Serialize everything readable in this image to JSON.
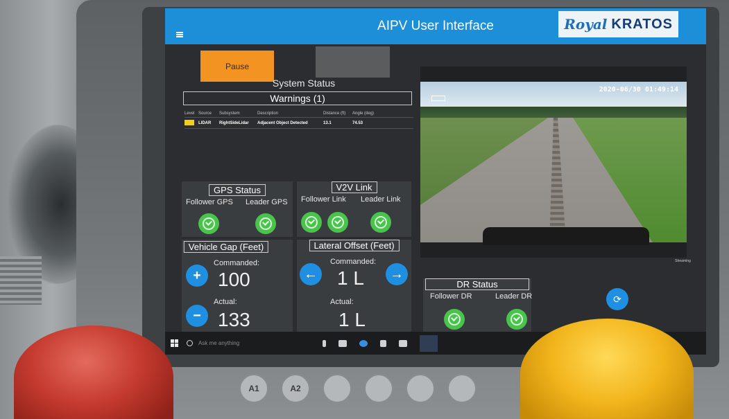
{
  "header": {
    "title": "AIPV User Interface",
    "brand_left": "Royal",
    "brand_right": "KRATOS"
  },
  "controls": {
    "pause_label": "Pause"
  },
  "system_status": {
    "title": "System Status",
    "warnings_title": "Warnings (1)",
    "columns": [
      "Level",
      "Source",
      "Subsystem",
      "Description",
      "Distance (ft)",
      "Angle (deg)"
    ],
    "rows": [
      {
        "source": "LIDAR",
        "subsystem": "RightSideLidar",
        "description": "Adjacent Object Detected",
        "distance": "13.1",
        "angle": "74.53"
      }
    ]
  },
  "gps": {
    "title": "GPS Status",
    "follower": "Follower GPS",
    "leader": "Leader GPS"
  },
  "v2v": {
    "title": "V2V Link",
    "follower": "Follower Link",
    "leader": "Leader Link"
  },
  "gap": {
    "title": "Vehicle Gap (Feet)",
    "commanded_label": "Commanded:",
    "commanded": "100",
    "actual_label": "Actual:",
    "actual": "133"
  },
  "offset": {
    "title": "Lateral Offset (Feet)",
    "commanded_label": "Commanded:",
    "commanded": "1 L",
    "actual_label": "Actual:",
    "actual": "1 L"
  },
  "dr": {
    "title": "DR Status",
    "follower": "Follower DR",
    "leader": "Leader DR"
  },
  "camera": {
    "timestamp": "2020-06/30 01:49:14",
    "caption": "Streaming"
  },
  "taskbar": {
    "search_placeholder": "Ask me anything"
  },
  "hardware_buttons": [
    "A1",
    "A2"
  ],
  "colors": {
    "accent": "#1d8fd8",
    "pause": "#f39322",
    "ok": "#49c34b",
    "warning": "#f2cf18",
    "estop_red": "#c53a2f",
    "estop_yellow": "#f2b51c"
  }
}
